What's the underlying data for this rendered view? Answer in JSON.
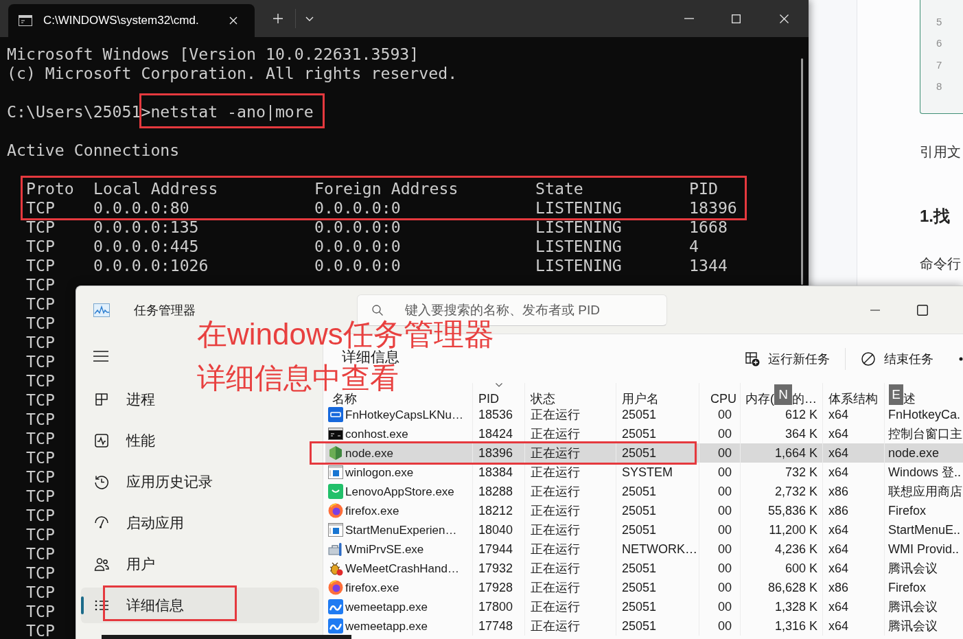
{
  "terminal": {
    "tab": {
      "title": "C:\\WINDOWS\\system32\\cmd.",
      "selected": true
    },
    "lines": [
      "Microsoft Windows [Version 10.0.22631.3593]",
      "(c) Microsoft Corporation. All rights reserved."
    ],
    "prompt": "C:\\Users\\25051>netstat -ano|more",
    "heading": "Active Connections",
    "table": {
      "columns": [
        "Proto",
        "Local Address",
        "Foreign Address",
        "State",
        "PID"
      ],
      "rows": [
        [
          "TCP",
          "0.0.0.0:80",
          "0.0.0.0:0",
          "LISTENING",
          "18396"
        ],
        [
          "TCP",
          "0.0.0.0:135",
          "0.0.0.0:0",
          "LISTENING",
          "1668"
        ],
        [
          "TCP",
          "0.0.0.0:445",
          "0.0.0.0:0",
          "LISTENING",
          "4"
        ],
        [
          "TCP",
          "0.0.0.0:1026",
          "0.0.0.0:0",
          "LISTENING",
          "1344"
        ],
        [
          "TCP"
        ],
        [
          "TCP"
        ],
        [
          "TCP"
        ],
        [
          "TCP"
        ],
        [
          "TCP"
        ],
        [
          "TCP"
        ],
        [
          "TCP"
        ],
        [
          "TCP"
        ],
        [
          "TCP"
        ],
        [
          "TCP"
        ],
        [
          "TCP"
        ],
        [
          "TCP"
        ],
        [
          "TCP"
        ],
        [
          "TCP"
        ],
        [
          "TCP"
        ],
        [
          "TCP"
        ],
        [
          "TCP"
        ],
        [
          "TCP"
        ],
        [
          "TCP"
        ]
      ]
    }
  },
  "document": {
    "code_line_numbers": [
      "5",
      "6",
      "7",
      "8"
    ],
    "paragraphs": [
      {
        "kind": "body",
        "text": "引用文"
      },
      {
        "kind": "heading",
        "text": "1.找"
      },
      {
        "kind": "body",
        "text": "命令行"
      }
    ]
  },
  "task_manager": {
    "title": "任务管理器",
    "search": {
      "placeholder": "键入要搜索的名称、发布者或 PID"
    },
    "nav": [
      {
        "kind": "processes",
        "label": "进程",
        "selected": false
      },
      {
        "kind": "performance",
        "label": "性能",
        "selected": false
      },
      {
        "kind": "history",
        "label": "应用历史记录",
        "selected": false
      },
      {
        "kind": "startup",
        "label": "启动应用",
        "selected": false
      },
      {
        "kind": "users",
        "label": "用户",
        "selected": false
      },
      {
        "kind": "details",
        "label": "详细信息",
        "selected": true
      }
    ],
    "page_title": "详细信息",
    "actions": [
      {
        "kind": "run",
        "label": "运行新任务"
      },
      {
        "kind": "end",
        "label": "结束任务"
      }
    ],
    "table": {
      "columns": [
        {
          "label": "名称",
          "sorted": false
        },
        {
          "label": "PID",
          "sorted": true
        },
        {
          "label": "状态",
          "sorted": false
        },
        {
          "label": "用户名",
          "sorted": false
        },
        {
          "label": "CPU",
          "sorted": false
        },
        {
          "label": "内存(",
          "keytip": "N",
          "label_after": "的…",
          "sorted": false
        },
        {
          "label": "体系结构",
          "sorted": false
        },
        {
          "keytip": "E",
          "label_after": "述",
          "sorted": false
        }
      ],
      "rows": [
        {
          "kind": "fn",
          "name": "FnHotkeyCapsLKNu…",
          "pid": "18536",
          "status": "正在运行",
          "user": "25051",
          "cpu": "00",
          "memory": "612 K",
          "arch": "x64",
          "description": "FnHotkeyCa.",
          "selected": false
        },
        {
          "kind": "console",
          "name": "conhost.exe",
          "pid": "18424",
          "status": "正在运行",
          "user": "25051",
          "cpu": "00",
          "memory": "364 K",
          "arch": "x64",
          "description": "控制台窗口主",
          "selected": false
        },
        {
          "kind": "node",
          "name": "node.exe",
          "pid": "18396",
          "status": "正在运行",
          "user": "25051",
          "cpu": "00",
          "memory": "1,664 K",
          "arch": "x64",
          "description": "node.exe",
          "selected": true
        },
        {
          "kind": "window",
          "name": "winlogon.exe",
          "pid": "18384",
          "status": "正在运行",
          "user": "SYSTEM",
          "cpu": "00",
          "memory": "732 K",
          "arch": "x64",
          "description": "Windows 登..",
          "selected": false
        },
        {
          "kind": "store",
          "name": "LenovoAppStore.exe",
          "pid": "18288",
          "status": "正在运行",
          "user": "25051",
          "cpu": "00",
          "memory": "2,732 K",
          "arch": "x86",
          "description": "联想应用商店",
          "selected": false
        },
        {
          "kind": "firefox",
          "name": "firefox.exe",
          "pid": "18212",
          "status": "正在运行",
          "user": "25051",
          "cpu": "00",
          "memory": "55,836 K",
          "arch": "x86",
          "description": "Firefox",
          "selected": false
        },
        {
          "kind": "window",
          "name": "StartMenuExperien…",
          "pid": "18040",
          "status": "正在运行",
          "user": "25051",
          "cpu": "00",
          "memory": "11,200 K",
          "arch": "x64",
          "description": "StartMenuE..",
          "selected": false
        },
        {
          "kind": "wmi",
          "name": "WmiPrvSE.exe",
          "pid": "17944",
          "status": "正在运行",
          "user": "NETWORK…",
          "cpu": "00",
          "memory": "4,236 K",
          "arch": "x64",
          "description": "WMI Provid..",
          "selected": false
        },
        {
          "kind": "crash",
          "name": "WeMeetCrashHand…",
          "pid": "17932",
          "status": "正在运行",
          "user": "25051",
          "cpu": "00",
          "memory": "600 K",
          "arch": "x64",
          "description": "腾讯会议",
          "selected": false
        },
        {
          "kind": "firefox",
          "name": "firefox.exe",
          "pid": "17928",
          "status": "正在运行",
          "user": "25051",
          "cpu": "00",
          "memory": "86,628 K",
          "arch": "x86",
          "description": "Firefox",
          "selected": false
        },
        {
          "kind": "wemeet",
          "name": "wemeetapp.exe",
          "pid": "17800",
          "status": "正在运行",
          "user": "25051",
          "cpu": "00",
          "memory": "1,328 K",
          "arch": "x64",
          "description": "腾讯会议",
          "selected": false
        },
        {
          "kind": "wemeet",
          "name": "wemeetapp.exe",
          "pid": "17748",
          "status": "正在运行",
          "user": "25051",
          "cpu": "00",
          "memory": "1,316 K",
          "arch": "x64",
          "description": "腾讯会议",
          "selected": false
        }
      ]
    }
  },
  "annotation": {
    "lines": [
      "在windows任务管理器",
      "详细信息中查看"
    ]
  }
}
